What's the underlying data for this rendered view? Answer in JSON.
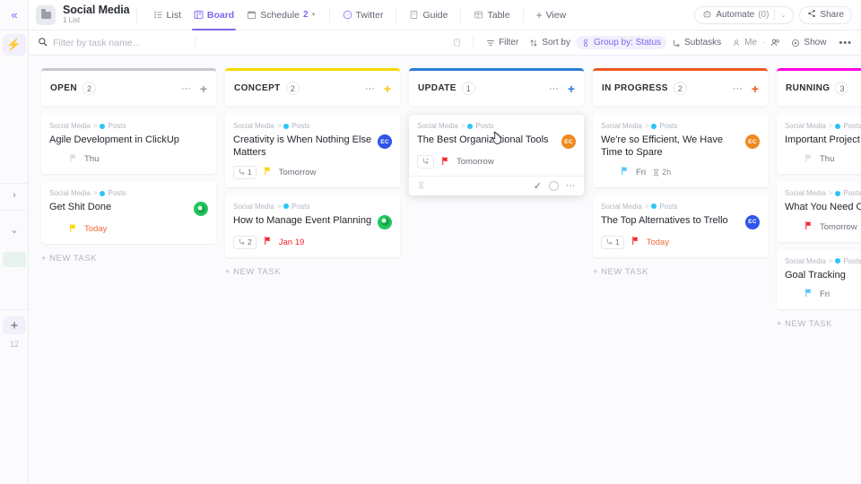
{
  "rail": {
    "collapse_icon": "chevron-double-left",
    "bolt_icon": "lightning-bolt",
    "arrow_right": "›",
    "arrow_down": "⌄",
    "plus": "+",
    "count": "12"
  },
  "header": {
    "folder_icon": "folder-icon",
    "title": "Social Media",
    "subtitle": "1 List",
    "tabs": [
      {
        "label": "List",
        "icon": "list-icon",
        "active": false,
        "count": "",
        "caret": false
      },
      {
        "label": "Board",
        "icon": "board-icon",
        "active": true,
        "count": "",
        "caret": false
      },
      {
        "label": "Schedule",
        "icon": "calendar-icon",
        "active": false,
        "count": "2",
        "caret": true
      },
      {
        "label": "Twitter",
        "icon": "twitter-icon",
        "active": false,
        "count": "",
        "caret": false
      },
      {
        "label": "Guide",
        "icon": "doc-icon",
        "active": false,
        "count": "",
        "caret": false
      },
      {
        "label": "Table",
        "icon": "table-icon",
        "active": false,
        "count": "",
        "caret": false
      },
      {
        "label": "View",
        "icon": "plus-icon",
        "active": false,
        "count": "",
        "caret": false
      }
    ],
    "automate": {
      "label": "Automate",
      "count": "(0)",
      "icon": "robot-icon",
      "caret": "⌄"
    },
    "share": {
      "label": "Share",
      "icon": "share-icon"
    }
  },
  "toolbar": {
    "search_placeholder": "Filter by task name...",
    "search_value": "",
    "search_icon": "search-icon",
    "copy_icon": "duplicate-icon",
    "buttons": [
      {
        "label": "Filter",
        "icon": "filter-icon",
        "highlight": false
      },
      {
        "label": "Sort by",
        "icon": "sort-icon",
        "highlight": false
      },
      {
        "label": "Group by: Status",
        "icon": "group-icon",
        "highlight": true
      },
      {
        "label": "Subtasks",
        "icon": "subtask-icon",
        "highlight": false
      },
      {
        "label": "Me",
        "icon": "person-icon",
        "highlight": false,
        "dim": true
      },
      {
        "label": "",
        "icon": "people-icon",
        "highlight": false
      },
      {
        "label": "Show",
        "icon": "eye-icon",
        "highlight": false
      }
    ],
    "more": "•••"
  },
  "board": {
    "new_task_label": "+ NEW TASK",
    "columns": [
      {
        "name": "OPEN",
        "count": "2",
        "color": "#c6c9cf",
        "plus_color": "#9a9ea7",
        "show_new_task": true,
        "cards": [
          {
            "breadcrumb_list": "Social Media",
            "breadcrumb_sep": ">",
            "breadcrumb_item": "Posts",
            "title": "Agile Development in ClickUp",
            "avatar": null,
            "subtasks": "",
            "flag_color": "#d9dce1",
            "due": "Thu",
            "due_color": "#6b7079",
            "time": "",
            "hovered": false
          },
          {
            "breadcrumb_list": "Social Media",
            "breadcrumb_sep": ">",
            "breadcrumb_item": "Posts",
            "title": "Get Shit Done",
            "avatar": {
              "initials": "",
              "color": "#22c55e",
              "photo": true
            },
            "subtasks": "",
            "flag_color": "#ffd400",
            "due": "Today",
            "due_color": "#f06a3e",
            "time": "",
            "hovered": false
          }
        ]
      },
      {
        "name": "CONCEPT",
        "count": "2",
        "color": "#f5d800",
        "plus_color": "#f5c800",
        "show_new_task": true,
        "cards": [
          {
            "breadcrumb_list": "Social Media",
            "breadcrumb_sep": ">",
            "breadcrumb_item": "Posts",
            "title": "Creativity is When Nothing Else Matters",
            "avatar": {
              "initials": "EC",
              "color": "#2f54eb",
              "photo": false
            },
            "subtasks": "1",
            "flag_color": "#ffd400",
            "due": "Tomorrow",
            "due_color": "#6b7079",
            "time": "",
            "hovered": false
          },
          {
            "breadcrumb_list": "Social Media",
            "breadcrumb_sep": ">",
            "breadcrumb_item": "Posts",
            "title": "How to Manage Event Planning",
            "avatar": {
              "initials": "",
              "color": "#22c55e",
              "photo": true
            },
            "subtasks": "2",
            "flag_color": "#f5222d",
            "due": "Jan 19",
            "due_color": "#f5222d",
            "time": "",
            "hovered": false
          }
        ]
      },
      {
        "name": "UPDATE",
        "count": "1",
        "color": "#2b7bd4",
        "plus_color": "#2b7bd4",
        "show_new_task": false,
        "cards": [
          {
            "breadcrumb_list": "Social Media",
            "breadcrumb_sep": ">",
            "breadcrumb_item": "Posts",
            "title": "The Best Organizational Tools",
            "avatar": {
              "initials": "EC",
              "color": "#f0881f",
              "photo": false
            },
            "subtasks": "+",
            "flag_color": "#f5222d",
            "due": "Tomorrow",
            "due_color": "#6b7079",
            "time": "",
            "hovered": true,
            "footer": {
              "hourglass_icon": "hourglass-icon",
              "check_icon": "check-icon",
              "circle_icon": "status-circle-icon",
              "dots_icon": "more-icon"
            }
          }
        ]
      },
      {
        "name": "IN PROGRESS",
        "count": "2",
        "color": "#f0581f",
        "plus_color": "#f0581f",
        "show_new_task": true,
        "cards": [
          {
            "breadcrumb_list": "Social Media",
            "breadcrumb_sep": ">",
            "breadcrumb_item": "Posts",
            "title": "We're so Efficient, We Have Time to Spare",
            "avatar": {
              "initials": "EC",
              "color": "#f0881f",
              "photo": false
            },
            "subtasks": "",
            "flag_color": "#4fc3f7",
            "due": "Fri",
            "due_color": "#6b7079",
            "time": "2h",
            "hovered": false
          },
          {
            "breadcrumb_list": "Social Media",
            "breadcrumb_sep": ">",
            "breadcrumb_item": "Posts",
            "title": "The Top Alternatives to Trello",
            "avatar": {
              "initials": "EC",
              "color": "#2f54eb",
              "photo": false
            },
            "subtasks": "1",
            "flag_color": "#f5222d",
            "due": "Today",
            "due_color": "#f06a3e",
            "time": "",
            "hovered": false
          }
        ]
      },
      {
        "name": "RUNNING",
        "count": "3",
        "color": "#ff00e6",
        "plus_color": "#ff00e6",
        "show_new_task": true,
        "cards": [
          {
            "breadcrumb_list": "Social Media",
            "breadcrumb_sep": ">",
            "breadcrumb_item": "Posts",
            "title": "Important Project Tips for Students",
            "avatar": null,
            "subtasks": "",
            "flag_color": "#d9dce1",
            "due": "Thu",
            "due_color": "#6b7079",
            "time": "",
            "hovered": false
          },
          {
            "breadcrumb_list": "Social Media",
            "breadcrumb_sep": ">",
            "breadcrumb_item": "Posts",
            "title": "What You Need OKRs",
            "avatar": null,
            "subtasks": "",
            "flag_color": "#f5222d",
            "due": "Tomorrow",
            "due_color": "#6b7079",
            "time": "",
            "hovered": false
          },
          {
            "breadcrumb_list": "Social Media",
            "breadcrumb_sep": ">",
            "breadcrumb_item": "Posts",
            "title": "Goal Tracking",
            "avatar": null,
            "subtasks": "",
            "flag_color": "#4fc3f7",
            "due": "Fri",
            "due_color": "#6b7079",
            "time": "",
            "hovered": false
          }
        ]
      }
    ]
  }
}
